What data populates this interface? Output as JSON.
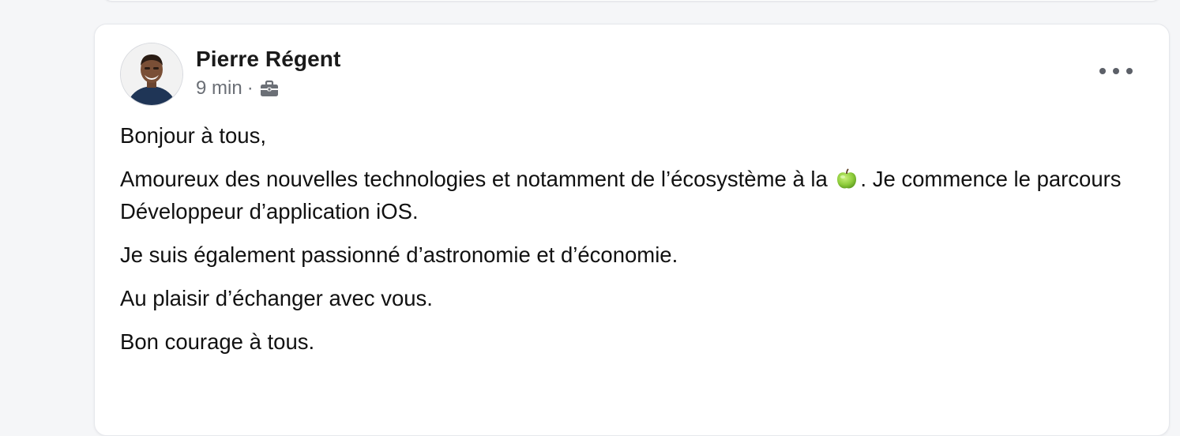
{
  "post": {
    "author": {
      "name": "Pierre Régent"
    },
    "meta": {
      "time": "9 min",
      "separator": "·",
      "visibility_icon": "briefcase-icon"
    },
    "menu_icon": "more-horizontal-icon",
    "body": {
      "greeting": "Bonjour à tous,",
      "line2_before_emoji": "Amoureux des nouvelles technologies et notamment de l’écosystème à la",
      "emoji": "apple-emoji",
      "line2_after_emoji": ". Je commence le parcours Développeur d’application iOS.",
      "line3": "Je suis également passionné d’astronomie et d’économie.",
      "line4": "Au plaisir d’échanger avec vous.",
      "line5": "Bon courage à tous."
    }
  },
  "colors": {
    "page_background": "#f5f6f8",
    "card_background": "#ffffff",
    "meta_text": "#6b6f76"
  }
}
